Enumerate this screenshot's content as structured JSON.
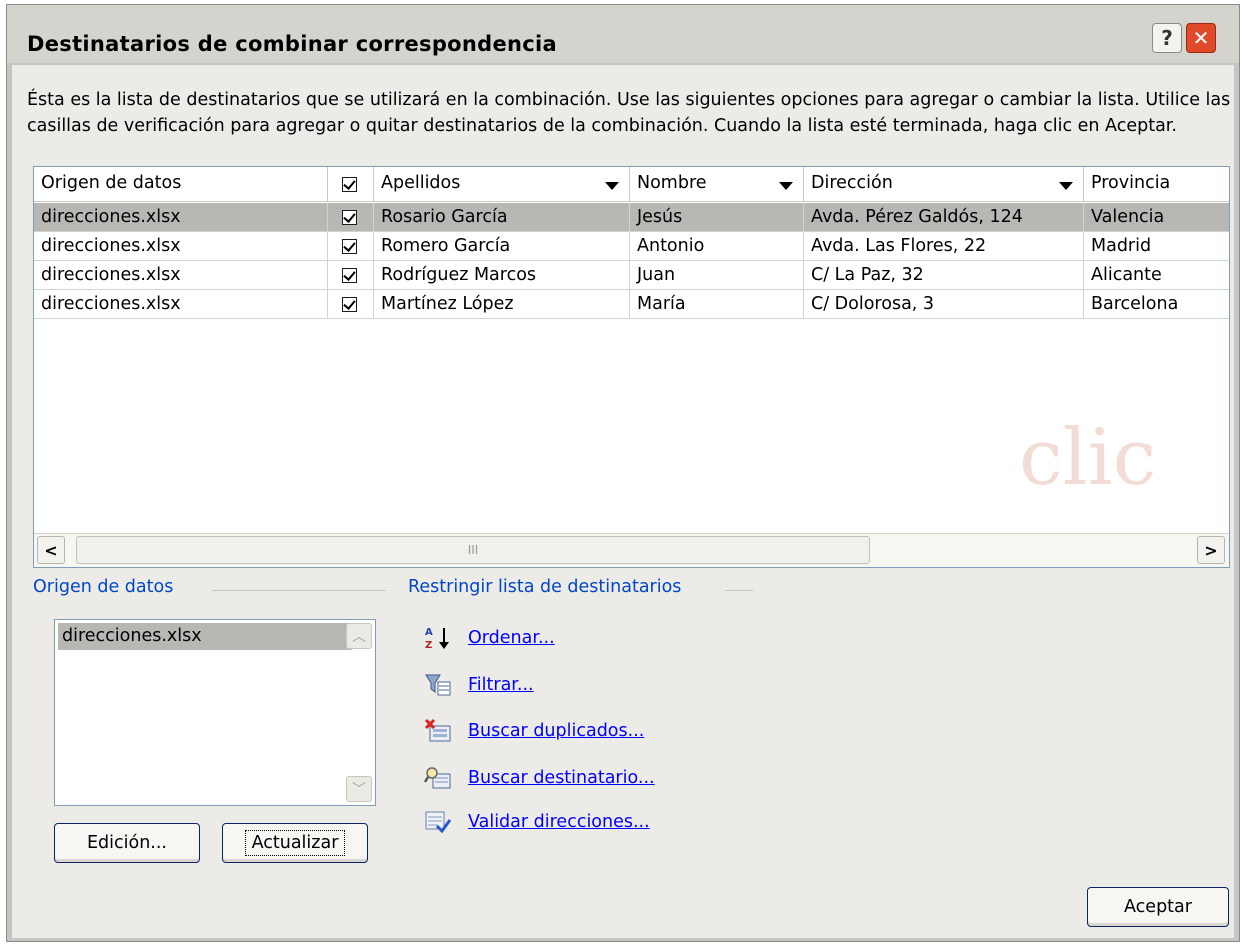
{
  "window": {
    "title": "Destinatarios de combinar correspondencia",
    "help_label": "?",
    "close_label": "✕"
  },
  "description": "Ésta es la lista de destinatarios que se utilizará en la combinación. Use las siguientes opciones para agregar o cambiar la lista. Utilice las casillas de verificación para agregar o quitar destinatarios de la combinación. Cuando la lista esté terminada, haga clic en Aceptar.",
  "grid": {
    "columns": [
      "Origen de datos",
      "Apellidos",
      "Nombre",
      "Dirección",
      "Provincia"
    ],
    "rows": [
      {
        "origen": "direcciones.xlsx",
        "checked": true,
        "apellidos": "Rosario García",
        "nombre": "Jesús",
        "direccion": "Avda. Pérez Galdós, 124",
        "provincia": "Valencia",
        "selected": true
      },
      {
        "origen": "direcciones.xlsx",
        "checked": true,
        "apellidos": "Romero García",
        "nombre": "Antonio",
        "direccion": "Avda. Las Flores, 22",
        "provincia": "Madrid",
        "selected": false
      },
      {
        "origen": "direcciones.xlsx",
        "checked": true,
        "apellidos": "Rodríguez Marcos",
        "nombre": "Juan",
        "direccion": "C/ La Paz, 32",
        "provincia": "Alicante",
        "selected": false
      },
      {
        "origen": "direcciones.xlsx",
        "checked": true,
        "apellidos": "Martínez López",
        "nombre": "María",
        "direccion": "C/ Dolorosa, 3",
        "provincia": "Barcelona",
        "selected": false
      }
    ],
    "scroll_left": "<",
    "scroll_right": ">",
    "scroll_grip": "III"
  },
  "datasource": {
    "title": "Origen de datos",
    "items": [
      "direcciones.xlsx"
    ],
    "scroll_up": "︿",
    "scroll_down": "﹀",
    "edit_button": "Edición...",
    "refresh_button": "Actualizar"
  },
  "restrict": {
    "title": "Restringir lista de destinatarios",
    "links": [
      {
        "label": "Ordenar...",
        "icon": "sort-az-icon"
      },
      {
        "label": "Filtrar...",
        "icon": "filter-icon"
      },
      {
        "label": "Buscar duplicados...",
        "icon": "find-duplicates-icon"
      },
      {
        "label": "Buscar destinatario...",
        "icon": "find-recipient-icon"
      },
      {
        "label": "Validar direcciones...",
        "icon": "validate-addresses-icon"
      }
    ]
  },
  "footer": {
    "ok_button": "Aceptar"
  },
  "colors": {
    "accent_text": "#0047c7",
    "link": "#0000ff",
    "selected_row": "#b8b7b3"
  }
}
